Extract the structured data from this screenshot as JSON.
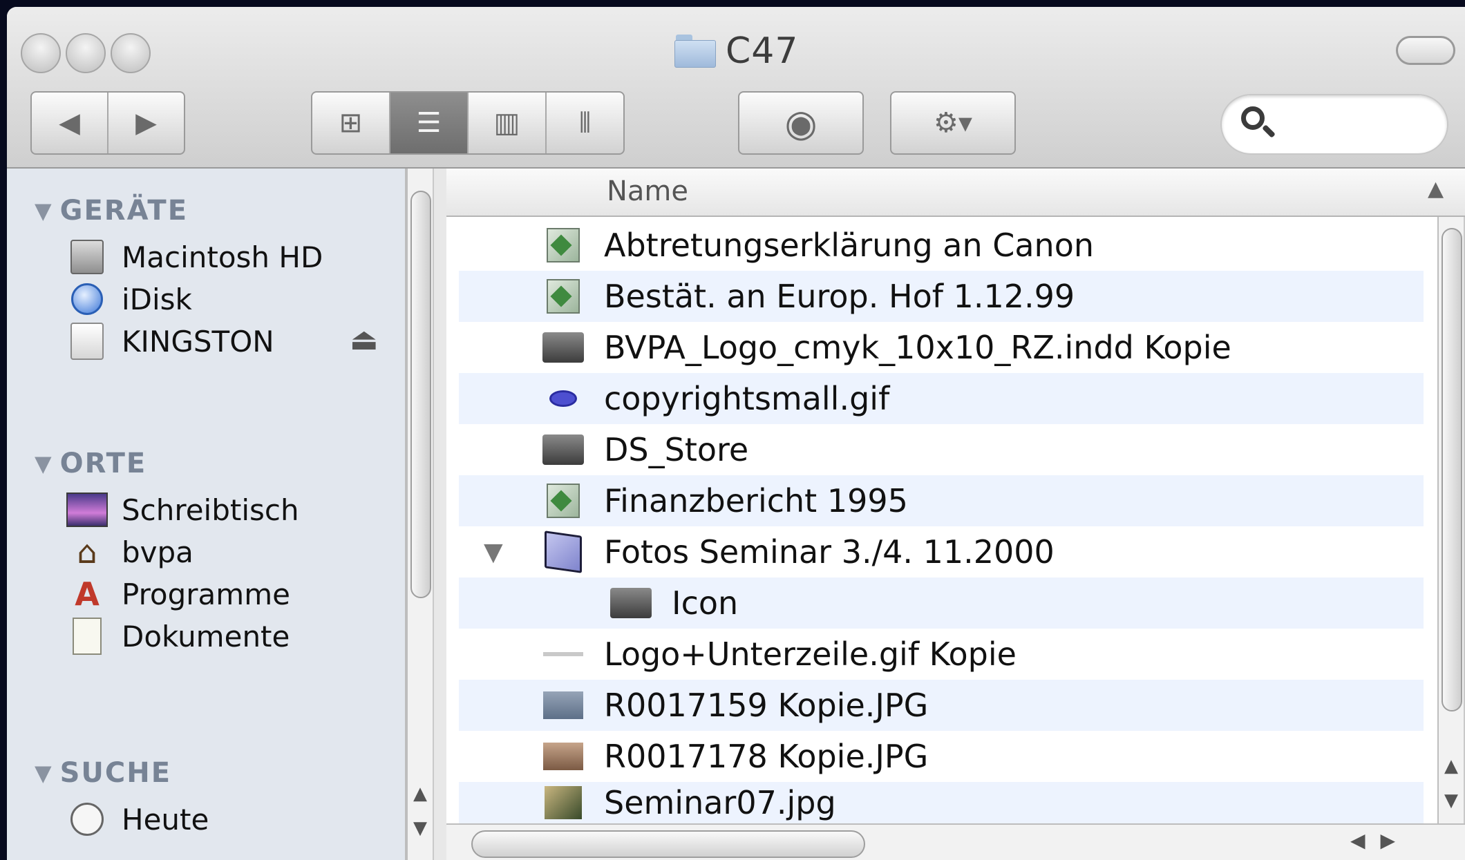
{
  "window": {
    "title": "C47"
  },
  "toolbar": {
    "nav": {
      "back": "◀",
      "forward": "▶"
    },
    "views": [
      {
        "name": "icon-view",
        "glyph": "⊞",
        "active": false
      },
      {
        "name": "list-view",
        "glyph": "☰",
        "active": true
      },
      {
        "name": "column-view",
        "glyph": "▥",
        "active": false
      },
      {
        "name": "coverflow-view",
        "glyph": "⦀",
        "active": false
      }
    ],
    "quicklook": "◉",
    "action": "⚙▾"
  },
  "sidebar": {
    "devices_header": "GERÄTE",
    "devices": [
      {
        "label": "Macintosh HD",
        "icon": "harddisk-icon"
      },
      {
        "label": "iDisk",
        "icon": "idisk-icon"
      },
      {
        "label": "KINGSTON",
        "icon": "usb-drive-icon",
        "eject": "⏏"
      }
    ],
    "places_header": "ORTE",
    "places": [
      {
        "label": "Schreibtisch",
        "icon": "desktop-icon"
      },
      {
        "label": "bvpa",
        "icon": "home-icon"
      },
      {
        "label": "Programme",
        "icon": "applications-icon"
      },
      {
        "label": "Dokumente",
        "icon": "documents-icon"
      }
    ],
    "search_header": "SUCHE",
    "searches": [
      {
        "label": "Heute",
        "icon": "clock-icon"
      }
    ]
  },
  "list": {
    "column_name": "Name",
    "sort_indicator": "▲",
    "rows": [
      {
        "name": "Abtretungserklärung an Canon",
        "icon": "doc"
      },
      {
        "name": "Bestät. an Europ. Hof 1.12.99",
        "icon": "doc"
      },
      {
        "name": "BVPA_Logo_cmyk_10x10_RZ.indd Kopie",
        "icon": "dark"
      },
      {
        "name": "copyrightsmall.gif",
        "icon": "oval"
      },
      {
        "name": "DS_Store",
        "icon": "dark"
      },
      {
        "name": "Finanzbericht 1995",
        "icon": "doc"
      },
      {
        "name": "Fotos Seminar 3./4. 11.2000",
        "icon": "folder",
        "disclosure": "▼"
      },
      {
        "name": "Icon",
        "icon": "dark",
        "indent": true
      },
      {
        "name": "Logo+Unterzeile.gif Kopie",
        "icon": "line"
      },
      {
        "name": "R0017159 Kopie.JPG",
        "icon": "img1"
      },
      {
        "name": "R0017178 Kopie.JPG",
        "icon": "img2"
      },
      {
        "name": "Seminar07.jpg",
        "icon": "img3"
      }
    ]
  }
}
